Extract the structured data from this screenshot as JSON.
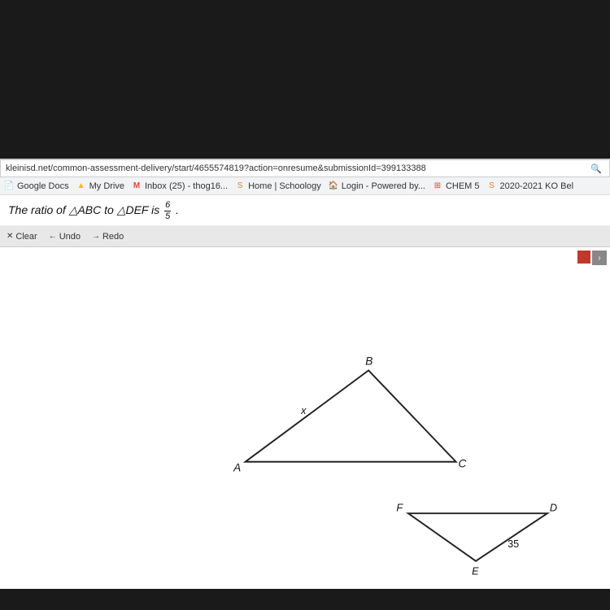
{
  "address_bar": {
    "url": "kleinisd.net/common-assessment-delivery/start/4655574819?action=onresume&submissionId=399133388",
    "search_icon": "🔍"
  },
  "bookmarks": [
    {
      "id": "google-docs",
      "label": "Google Docs",
      "icon": "📄",
      "icon_class": "icon-gdocs"
    },
    {
      "id": "my-drive",
      "label": "My Drive",
      "icon": "▲",
      "icon_class": "icon-gdrive"
    },
    {
      "id": "inbox",
      "label": "Inbox (25) - thog16...",
      "icon": "M",
      "icon_class": "icon-gmail"
    },
    {
      "id": "schoology",
      "label": "Home | Schoology",
      "icon": "S",
      "icon_class": "icon-schoology"
    },
    {
      "id": "login",
      "label": "Login - Powered by...",
      "icon": "🏠",
      "icon_class": "icon-login"
    },
    {
      "id": "chem5",
      "label": "CHEM 5",
      "icon": "⊞",
      "icon_class": "icon-chem"
    },
    {
      "id": "2020ко",
      "label": "2020-2021 KO Bel",
      "icon": "S",
      "icon_class": "icon-sch2"
    }
  ],
  "question": {
    "prefix": "The ratio of △ABC to △DEF is ",
    "fraction_num": "6",
    "fraction_den": "5",
    "suffix": "."
  },
  "toolbar": {
    "clear_label": "Clear",
    "undo_label": "Undo",
    "redo_label": "Redo"
  },
  "triangles": {
    "large": {
      "vertices": {
        "A": [
          300,
          270
        ],
        "B": [
          455,
          155
        ],
        "C": [
          565,
          270
        ]
      },
      "labels": {
        "A": "A",
        "B": "B",
        "C": "C",
        "x": "x"
      }
    },
    "small": {
      "vertices": {
        "F": [
          505,
          335
        ],
        "D": [
          680,
          335
        ],
        "E": [
          590,
          395
        ]
      },
      "labels": {
        "F": "F",
        "D": "D",
        "E": "E",
        "val": "35"
      }
    }
  },
  "colors": {
    "accent_red": "#c0392b",
    "bg_toolbar": "#e8e8e8",
    "bg_main": "#ffffff"
  }
}
